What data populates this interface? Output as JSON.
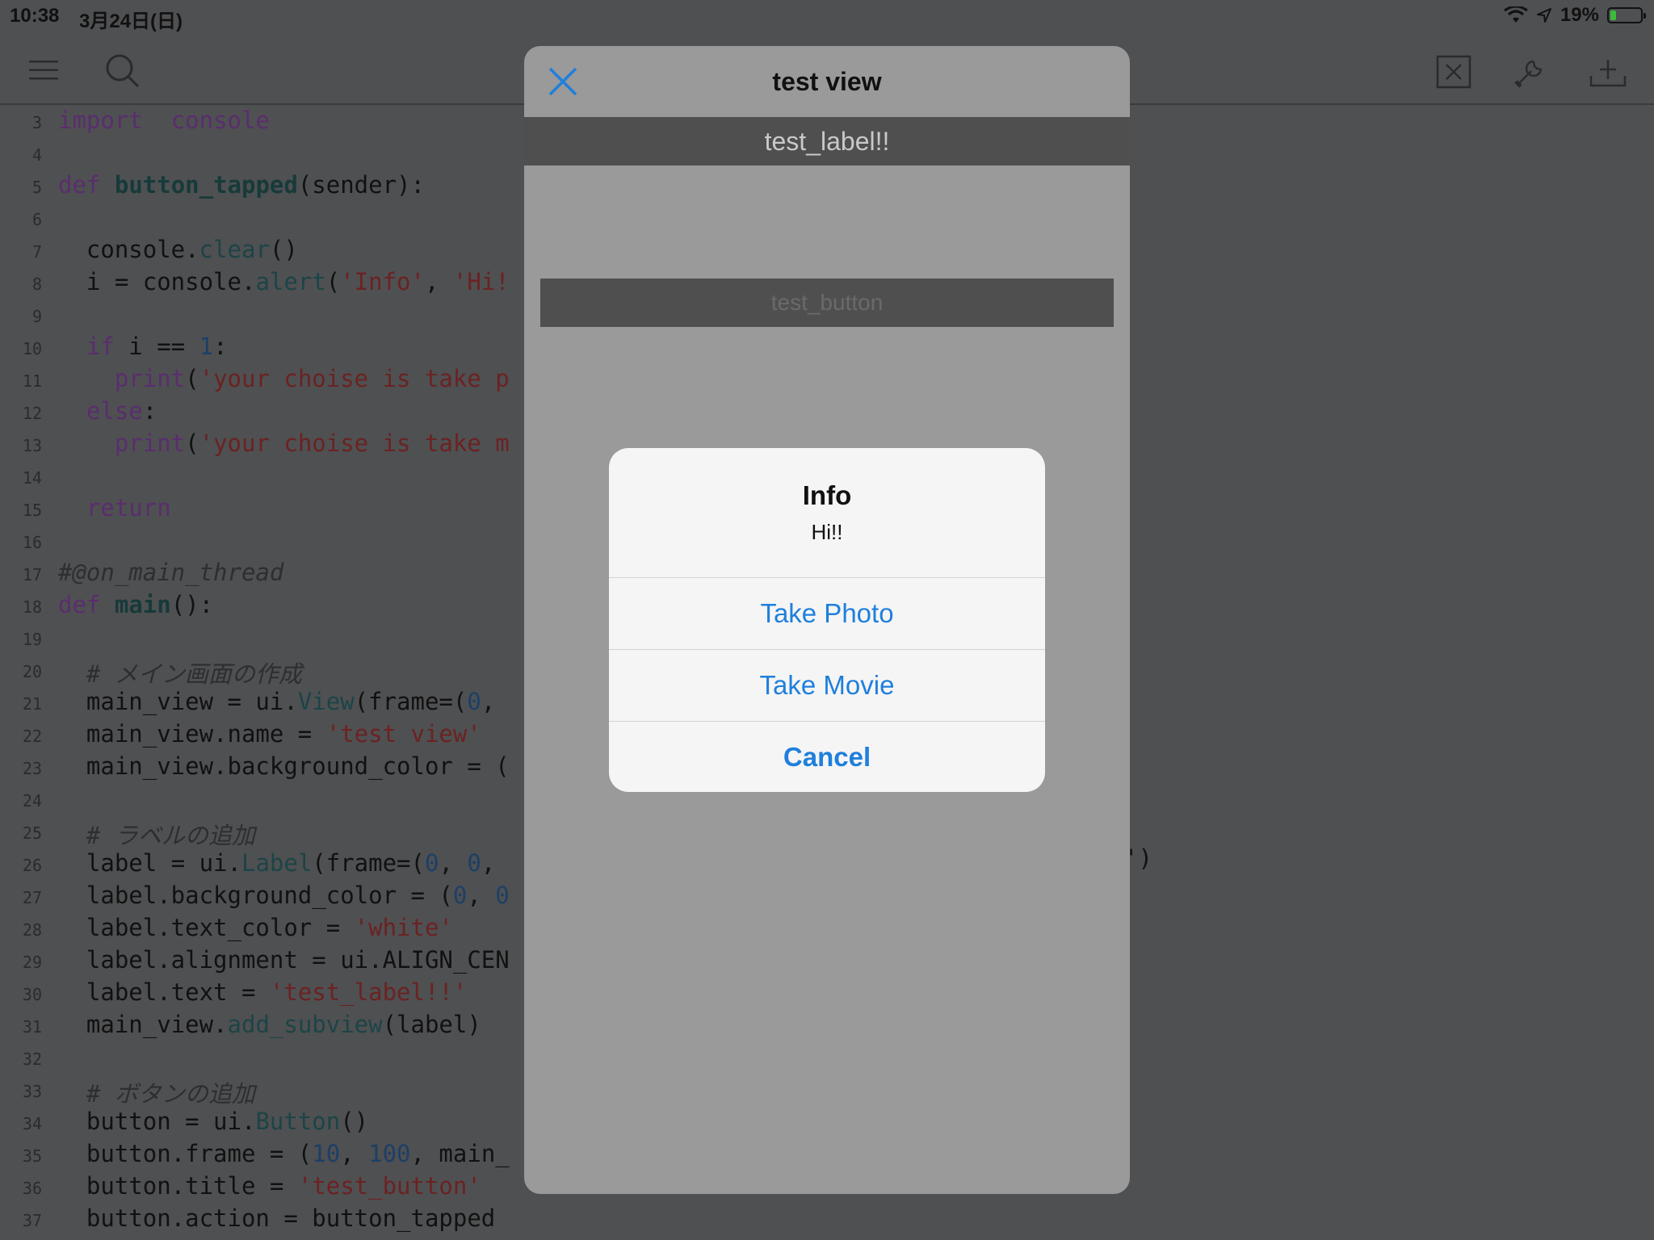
{
  "status_bar": {
    "time": "10:38",
    "date": "3月24日(日)",
    "battery_text": "19%",
    "battery_level": 0.19
  },
  "toolbar": {
    "left_icons": [
      "hamburger-icon",
      "search-icon"
    ],
    "right_icons": [
      "close-box-icon",
      "wrench-icon",
      "add-icon"
    ]
  },
  "editor": {
    "lines": [
      {
        "n": "3",
        "segs": [
          [
            "kw",
            "import"
          ],
          [
            "",
            "  "
          ],
          [
            "kw",
            "console"
          ]
        ]
      },
      {
        "n": "4",
        "segs": []
      },
      {
        "n": "5",
        "segs": [
          [
            "kw",
            "def"
          ],
          [
            "",
            " "
          ],
          [
            "fn",
            "button_tapped"
          ],
          [
            "",
            "(sender):"
          ]
        ]
      },
      {
        "n": "6",
        "segs": []
      },
      {
        "n": "7",
        "segs": [
          [
            "",
            "  console."
          ],
          [
            "mt",
            "clear"
          ],
          [
            "",
            "()"
          ]
        ]
      },
      {
        "n": "8",
        "segs": [
          [
            "",
            "  i = console."
          ],
          [
            "mt",
            "alert"
          ],
          [
            "",
            "("
          ],
          [
            "str",
            "'Info'"
          ],
          [
            "",
            ", "
          ],
          [
            "str",
            "'Hi!"
          ]
        ]
      },
      {
        "n": "9",
        "segs": []
      },
      {
        "n": "10",
        "segs": [
          [
            "",
            "  "
          ],
          [
            "kw",
            "if"
          ],
          [
            "",
            " i == "
          ],
          [
            "num",
            "1"
          ],
          [
            "",
            ":"
          ]
        ]
      },
      {
        "n": "11",
        "segs": [
          [
            "",
            "    "
          ],
          [
            "kw",
            "print"
          ],
          [
            "",
            "("
          ],
          [
            "str",
            "'your choise is take p"
          ]
        ]
      },
      {
        "n": "12",
        "segs": [
          [
            "",
            "  "
          ],
          [
            "kw",
            "else"
          ],
          [
            "",
            ":"
          ]
        ]
      },
      {
        "n": "13",
        "segs": [
          [
            "",
            "    "
          ],
          [
            "kw",
            "print"
          ],
          [
            "",
            "("
          ],
          [
            "str",
            "'your choise is take m"
          ]
        ]
      },
      {
        "n": "14",
        "segs": []
      },
      {
        "n": "15",
        "segs": [
          [
            "",
            "  "
          ],
          [
            "kw",
            "return"
          ]
        ]
      },
      {
        "n": "16",
        "segs": []
      },
      {
        "n": "17",
        "segs": [
          [
            "cm",
            "#@on_main_thread"
          ]
        ]
      },
      {
        "n": "18",
        "segs": [
          [
            "kw",
            "def"
          ],
          [
            "",
            " "
          ],
          [
            "fn",
            "main"
          ],
          [
            "",
            "():"
          ]
        ]
      },
      {
        "n": "19",
        "segs": []
      },
      {
        "n": "20",
        "segs": [
          [
            "",
            "  "
          ],
          [
            "cm",
            "# メイン画面の作成"
          ]
        ]
      },
      {
        "n": "21",
        "segs": [
          [
            "",
            "  main_view = ui."
          ],
          [
            "mt",
            "View"
          ],
          [
            "",
            "(frame=("
          ],
          [
            "num",
            "0"
          ],
          [
            "",
            ","
          ]
        ]
      },
      {
        "n": "22",
        "segs": [
          [
            "",
            "  main_view.name = "
          ],
          [
            "str",
            "'test view'"
          ]
        ]
      },
      {
        "n": "23",
        "segs": [
          [
            "",
            "  main_view.background_color = ("
          ]
        ]
      },
      {
        "n": "24",
        "segs": []
      },
      {
        "n": "25",
        "segs": [
          [
            "",
            "  "
          ],
          [
            "cm",
            "# ラベルの追加"
          ]
        ]
      },
      {
        "n": "26",
        "segs": [
          [
            "",
            "  label = ui."
          ],
          [
            "mt",
            "Label"
          ],
          [
            "",
            "(frame=("
          ],
          [
            "num",
            "0"
          ],
          [
            "",
            ", "
          ],
          [
            "num",
            "0"
          ],
          [
            "",
            ","
          ]
        ]
      },
      {
        "n": "27",
        "segs": [
          [
            "",
            "  label.background_color = ("
          ],
          [
            "num",
            "0"
          ],
          [
            "",
            ", "
          ],
          [
            "num",
            "0"
          ]
        ]
      },
      {
        "n": "28",
        "segs": [
          [
            "",
            "  label.text_color = "
          ],
          [
            "str",
            "'white'"
          ]
        ]
      },
      {
        "n": "29",
        "segs": [
          [
            "",
            "  label.alignment = ui.ALIGN_CEN"
          ]
        ]
      },
      {
        "n": "30",
        "segs": [
          [
            "",
            "  label.text = "
          ],
          [
            "str",
            "'test_label!!'"
          ]
        ]
      },
      {
        "n": "31",
        "segs": [
          [
            "",
            "  main_view."
          ],
          [
            "mt",
            "add_subview"
          ],
          [
            "",
            "(label)"
          ]
        ]
      },
      {
        "n": "32",
        "segs": []
      },
      {
        "n": "33",
        "segs": [
          [
            "",
            "  "
          ],
          [
            "cm",
            "# ボタンの追加"
          ]
        ]
      },
      {
        "n": "34",
        "segs": [
          [
            "",
            "  button = ui."
          ],
          [
            "mt",
            "Button"
          ],
          [
            "",
            "()"
          ]
        ]
      },
      {
        "n": "35",
        "segs": [
          [
            "",
            "  button.frame = ("
          ],
          [
            "num",
            "10"
          ],
          [
            "",
            ", "
          ],
          [
            "num",
            "100"
          ],
          [
            "",
            ", main_"
          ]
        ]
      },
      {
        "n": "36",
        "segs": [
          [
            "",
            "  button.title = "
          ],
          [
            "str",
            "'test_button'"
          ]
        ]
      },
      {
        "n": "37",
        "segs": [
          [
            "",
            "  button.action = button_tapped"
          ]
        ]
      }
    ],
    "stray_text": "')"
  },
  "sheet": {
    "title": "test view",
    "label_text": "test_label!!",
    "button_text": "test_button"
  },
  "alert": {
    "title": "Info",
    "message": "Hi!!",
    "buttons": [
      "Take Photo",
      "Take Movie",
      "Cancel"
    ]
  },
  "colors": {
    "accent": "#1f7fdc",
    "background_dim": "#4f5052",
    "sheet_bg": "#9a9a9a",
    "label_bg": "#4f4f4f"
  }
}
